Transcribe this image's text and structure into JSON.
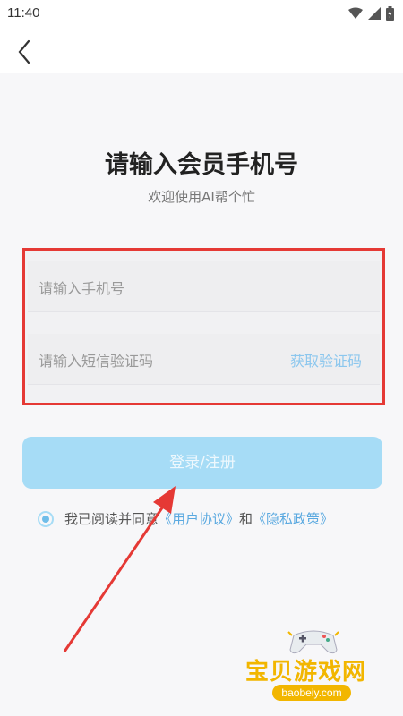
{
  "status_bar": {
    "time": "11:40"
  },
  "page": {
    "title": "请输入会员手机号",
    "subtitle": "欢迎使用AI帮个忙"
  },
  "form": {
    "phone_placeholder": "请输入手机号",
    "code_placeholder": "请输入短信验证码",
    "get_code_label": "获取验证码"
  },
  "login_button": {
    "label": "登录/注册"
  },
  "agreement": {
    "prefix": "我已阅读并同意",
    "user_agreement": "《用户协议》",
    "conjunction": "和",
    "privacy_policy": "《隐私政策》",
    "checked": true
  },
  "watermark": {
    "name": "宝贝游戏网",
    "url": "baobeiy.com"
  },
  "colors": {
    "accent_light": "#a6dcf6",
    "link": "#5aa9e0",
    "highlight_border": "#e53935",
    "annotation_arrow": "#e53935",
    "watermark": "#f2b600"
  },
  "icons": [
    "wifi-icon",
    "signal-icon",
    "battery-icon",
    "back-arrow-icon",
    "gamepad-icon"
  ]
}
